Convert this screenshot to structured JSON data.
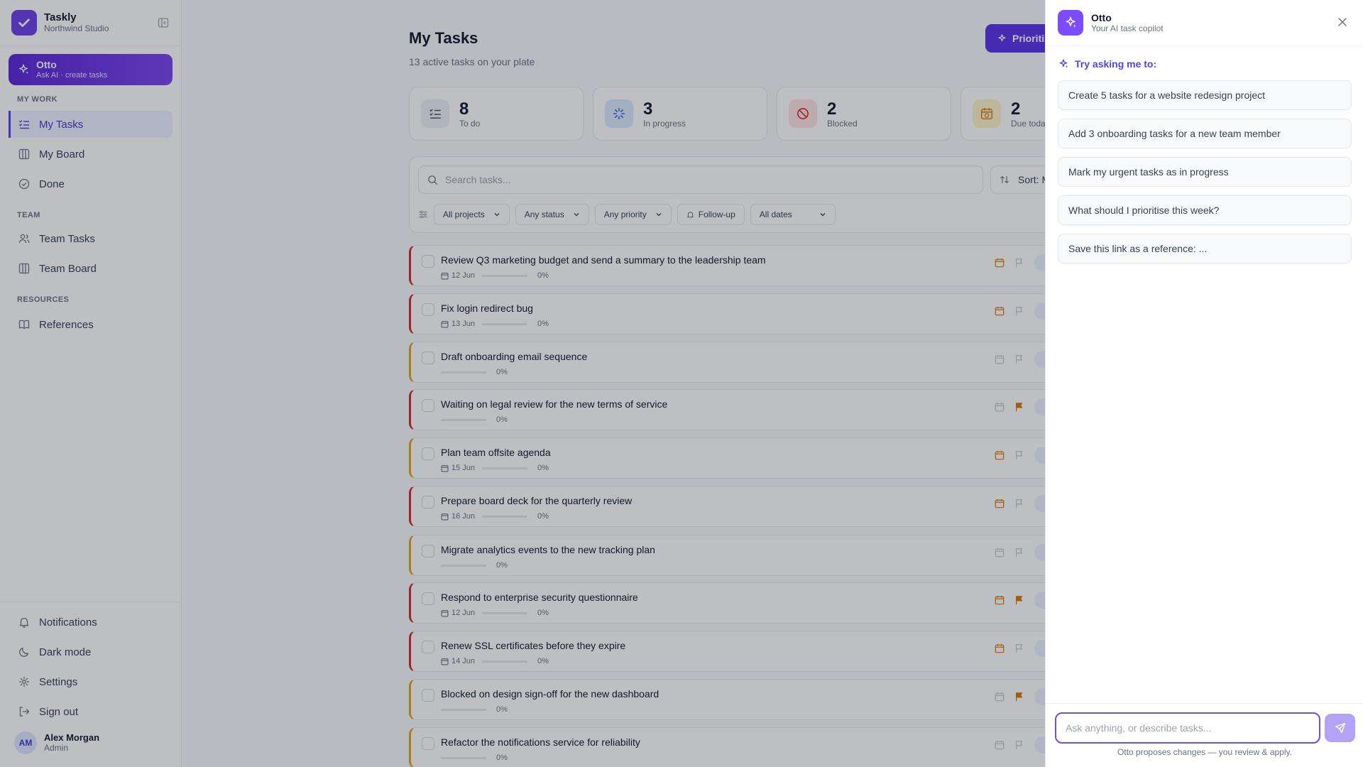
{
  "brand": {
    "name": "Taskly",
    "workspace": "Northwind Studio"
  },
  "otto_card": {
    "title": "Otto",
    "subtitle": "Ask AI · create tasks"
  },
  "nav": {
    "my_work_label": "MY WORK",
    "team_label": "TEAM",
    "resources_label": "RESOURCES",
    "items": {
      "my_tasks": "My Tasks",
      "my_board": "My Board",
      "done": "Done",
      "team_tasks": "Team Tasks",
      "team_board": "Team Board",
      "references": "References"
    },
    "bottom": {
      "notifications": "Notifications",
      "dark_mode": "Dark mode",
      "settings": "Settings",
      "sign_out": "Sign out"
    }
  },
  "user": {
    "initials": "AM",
    "name": "Alex Morgan",
    "role": "Admin"
  },
  "page": {
    "title": "My Tasks",
    "subtitle": "13 active tasks on your plate",
    "prioritize_label": "Prioritize"
  },
  "stats": [
    {
      "value": "8",
      "label": "To do"
    },
    {
      "value": "3",
      "label": "In progress"
    },
    {
      "value": "2",
      "label": "Blocked"
    },
    {
      "value": "2",
      "label": "Due today"
    }
  ],
  "filters": {
    "search_placeholder": "Search tasks...",
    "sort_label": "Sort: Manual",
    "projects": "All projects",
    "status": "Any status",
    "priority": "Any priority",
    "followup": "Follow-up",
    "dates": "All dates"
  },
  "tasks": [
    {
      "title": "Review Q3 marketing budget and send a summary to the leadership team",
      "date": "12 Jun",
      "progress": "0%",
      "flagged": false
    },
    {
      "title": "Fix login redirect bug",
      "date": "13 Jun",
      "progress": "0%",
      "flagged": false
    },
    {
      "title": "Draft onboarding email sequence",
      "date": "",
      "progress": "0%",
      "flagged": false
    },
    {
      "title": "Waiting on legal review for the new terms of service",
      "date": "",
      "progress": "0%",
      "flagged": true
    },
    {
      "title": "Plan team offsite agenda",
      "date": "15 Jun",
      "progress": "0%",
      "flagged": false
    },
    {
      "title": "Prepare board deck for the quarterly review",
      "date": "16 Jun",
      "progress": "0%",
      "flagged": false
    },
    {
      "title": "Migrate analytics events to the new tracking plan",
      "date": "",
      "progress": "0%",
      "flagged": false
    },
    {
      "title": "Respond to enterprise security questionnaire",
      "date": "12 Jun",
      "progress": "0%",
      "flagged": true
    },
    {
      "title": "Renew SSL certificates before they expire",
      "date": "14 Jun",
      "progress": "0%",
      "flagged": false
    },
    {
      "title": "Blocked on design sign-off for the new dashboard",
      "date": "",
      "progress": "0%",
      "flagged": true
    },
    {
      "title": "Refactor the notifications service for reliability",
      "date": "",
      "progress": "0%",
      "flagged": false
    }
  ],
  "drawer": {
    "title": "Otto",
    "subtitle": "Your AI task copilot",
    "try_label": "Try asking me to:",
    "suggestions": [
      "Create 5 tasks for a website redesign project",
      "Add 3 onboarding tasks for a new team member",
      "Mark my urgent tasks as in progress",
      "What should I prioritise this week?",
      "Save this link as a reference: ..."
    ],
    "input_placeholder": "Ask anything, or describe tasks...",
    "disclaimer": "Otto proposes changes — you review & apply."
  },
  "colors": {
    "accent": "#5b34e8",
    "danger": "#dc2626",
    "warning": "#e5a50a"
  }
}
